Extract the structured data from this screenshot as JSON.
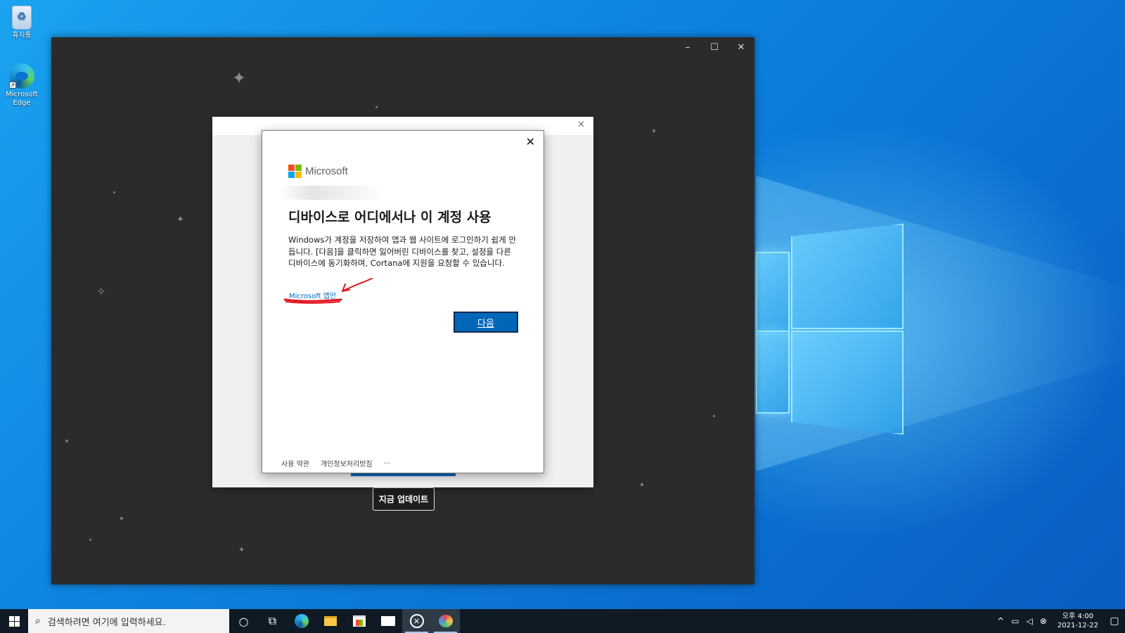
{
  "desktop": {
    "icons": [
      {
        "label": "휴지통"
      },
      {
        "label": "Microsoft Edge"
      }
    ]
  },
  "app_window": {
    "controls": {
      "minimize": "–",
      "maximize": "☐",
      "close": "✕"
    },
    "update_button": "지금 업데이트"
  },
  "outer_frame": {
    "close": "✕"
  },
  "dialog": {
    "close": "✕",
    "brand": "Microsoft",
    "title": "디바이스로 어디에서나 이 계정 사용",
    "body": "Windows가 계정을 저장하여 앱과 웹 사이트에 로그인하기 쉽게 만듭니다. [다음]을 클릭하면 잃어버린 디바이스를 찾고, 설정을 다른 디바이스에 동기화하며, Cortana에 지원을 요청할 수 있습니다.",
    "link": "Microsoft 앱만",
    "next_button": "다음",
    "footer": {
      "terms": "사용 약관",
      "privacy": "개인정보처리방침",
      "more": "..."
    }
  },
  "taskbar": {
    "search_placeholder": "검색하려면 여기에 입력하세요.",
    "clock": {
      "time": "오후 4:00",
      "date": "2021-12-22"
    }
  },
  "colors": {
    "accent": "#0067b8",
    "window_bg": "#2b2b2b",
    "taskbar_bg": "#0f1a24"
  }
}
